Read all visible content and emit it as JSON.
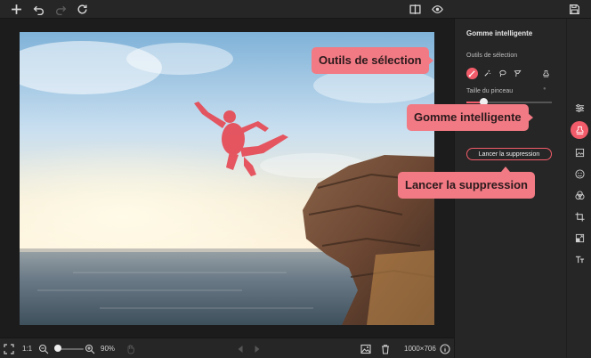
{
  "toolbar": {
    "icons": [
      "plus-icon",
      "undo-icon",
      "redo-icon",
      "refresh-icon",
      "compare-icon",
      "eye-icon",
      "save-icon"
    ]
  },
  "panel": {
    "title": "Gomme intelligente",
    "selection_tools_label": "Outils de sélection",
    "brush_size_label": "Taille du pinceau",
    "brush_size_value": 0.2,
    "remove_button_label": "Lancer la suppression"
  },
  "bottombar": {
    "ratio_label": "1:1",
    "zoom_label": "90%",
    "zoom_value": 0.1,
    "image_size_label": "1000×706"
  },
  "callouts": {
    "selection_tools": "Outils de sélection",
    "smart_eraser": "Gomme intelligente",
    "run_removal": "Lancer la suppression"
  },
  "colors": {
    "accent": "#f25c6a",
    "callout": "#f27a84",
    "panel": "#262626",
    "background": "#1c1c1c"
  }
}
